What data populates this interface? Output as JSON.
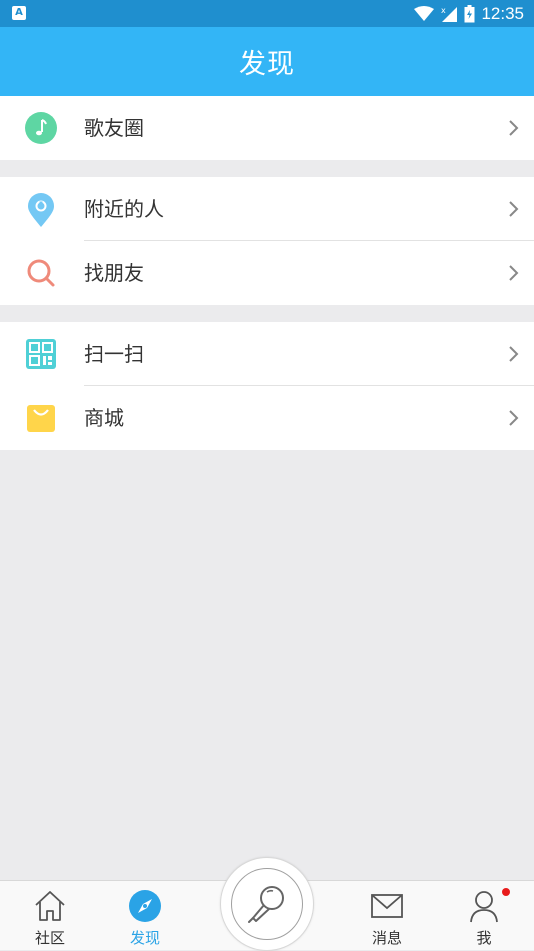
{
  "status_bar": {
    "time": "12:35",
    "notif_letter": "A"
  },
  "header": {
    "title": "发现"
  },
  "groups": [
    {
      "items": [
        {
          "label": "歌友圈",
          "icon": "music-note-icon"
        }
      ]
    },
    {
      "items": [
        {
          "label": "附近的人",
          "icon": "location-pin-icon"
        },
        {
          "label": "找朋友",
          "icon": "search-icon"
        }
      ]
    },
    {
      "items": [
        {
          "label": "扫一扫",
          "icon": "qr-code-icon"
        },
        {
          "label": "商城",
          "icon": "shopping-bag-icon"
        }
      ]
    }
  ],
  "tabbar": {
    "tabs": [
      {
        "label": "社区",
        "icon": "home-icon",
        "active": false
      },
      {
        "label": "发现",
        "icon": "compass-icon",
        "active": true
      },
      {
        "label": "",
        "icon": "microphone-icon",
        "active": false
      },
      {
        "label": "消息",
        "icon": "envelope-icon",
        "active": false
      },
      {
        "label": "我",
        "icon": "user-icon",
        "active": false,
        "badge": true
      }
    ]
  },
  "colors": {
    "header": "#33b5f6",
    "status_bar": "#1f8fcf",
    "active_tab": "#2aa3e6",
    "badge": "#e81c1c",
    "background": "#ebebed"
  }
}
